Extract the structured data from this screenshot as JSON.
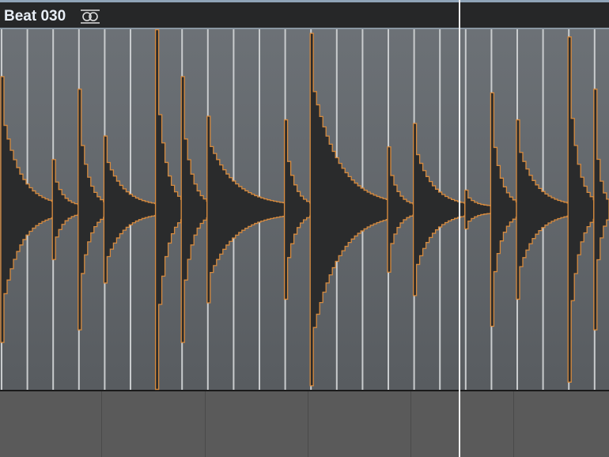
{
  "region": {
    "title": "Beat 030",
    "loop_icon": "loop-icon",
    "colors": {
      "waveform_fill": "#2a2b2c",
      "waveform_outline": "#d68a3e",
      "marker": "#c9ccce",
      "playhead": "#f2f2f2"
    }
  },
  "waveform": {
    "slice_count": 24,
    "hits": [
      {
        "slice": 0,
        "amplitude": 0.72
      },
      {
        "slice": 2,
        "amplitude": 0.26
      },
      {
        "slice": 3,
        "amplitude": 0.65
      },
      {
        "slice": 4,
        "amplitude": 0.39
      },
      {
        "slice": 6,
        "amplitude": 0.98
      },
      {
        "slice": 7,
        "amplitude": 0.72
      },
      {
        "slice": 8,
        "amplitude": 0.5
      },
      {
        "slice": 11,
        "amplitude": 0.48
      },
      {
        "slice": 12,
        "amplitude": 0.96
      },
      {
        "slice": 15,
        "amplitude": 0.33
      },
      {
        "slice": 16,
        "amplitude": 0.46
      },
      {
        "slice": 18,
        "amplitude": 0.09
      },
      {
        "slice": 19,
        "amplitude": 0.63
      },
      {
        "slice": 20,
        "amplitude": 0.48
      },
      {
        "slice": 22,
        "amplitude": 0.94
      },
      {
        "slice": 23,
        "amplitude": 0.65
      }
    ]
  },
  "playhead_slice": 17.8
}
